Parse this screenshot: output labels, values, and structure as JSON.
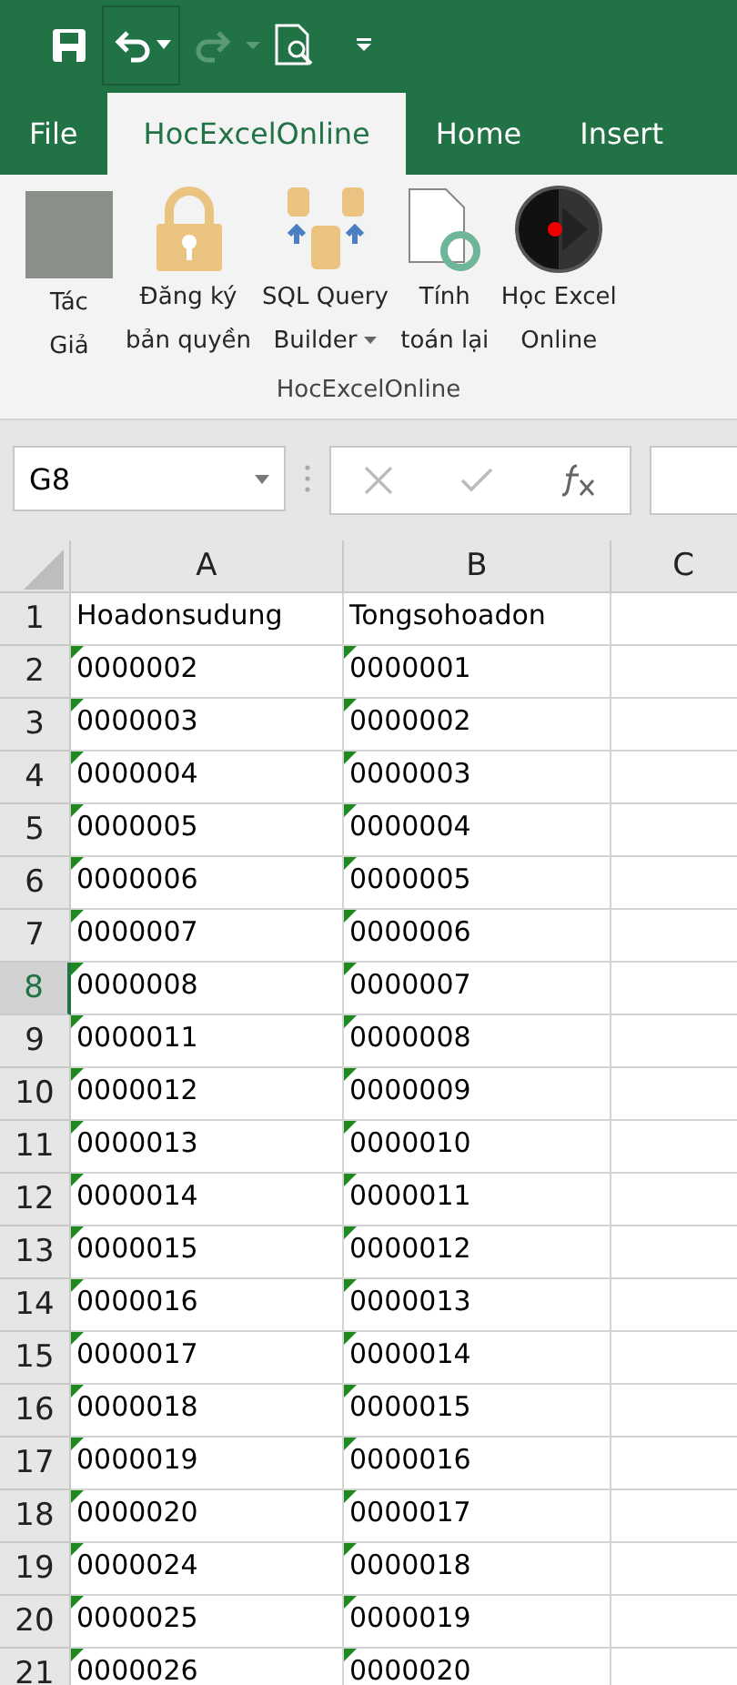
{
  "quick_access": {
    "undo_selected": true
  },
  "tabs": [
    {
      "label": "File",
      "selected": false
    },
    {
      "label": "HocExcelOnline",
      "selected": true
    },
    {
      "label": "Home",
      "selected": false
    },
    {
      "label": "Insert",
      "selected": false
    }
  ],
  "ribbon": {
    "buttons": [
      {
        "kind": "photo",
        "lines": [
          "Tác",
          "Giả"
        ]
      },
      {
        "kind": "lock",
        "lines": [
          "Đăng ký",
          "bản quyền"
        ]
      },
      {
        "kind": "database",
        "lines": [
          "SQL Query",
          "Builder"
        ],
        "dropdown": true
      },
      {
        "kind": "recalc",
        "lines": [
          "Tính",
          "toán lại"
        ]
      },
      {
        "kind": "play",
        "lines": [
          "Học Excel",
          "Online"
        ]
      }
    ],
    "group_label": "HocExcelOnline"
  },
  "name_box": {
    "value": "G8"
  },
  "columns": [
    "A",
    "B",
    "C"
  ],
  "rows": [
    {
      "number": "1",
      "cells": [
        "Hoadonsudung",
        "Tongsohoadon"
      ],
      "selected": false,
      "error_marks": false
    },
    {
      "number": "2",
      "cells": [
        "0000002",
        "0000001"
      ],
      "selected": false,
      "error_marks": true
    },
    {
      "number": "3",
      "cells": [
        "0000003",
        "0000002"
      ],
      "selected": false,
      "error_marks": true
    },
    {
      "number": "4",
      "cells": [
        "0000004",
        "0000003"
      ],
      "selected": false,
      "error_marks": true
    },
    {
      "number": "5",
      "cells": [
        "0000005",
        "0000004"
      ],
      "selected": false,
      "error_marks": true
    },
    {
      "number": "6",
      "cells": [
        "0000006",
        "0000005"
      ],
      "selected": false,
      "error_marks": true
    },
    {
      "number": "7",
      "cells": [
        "0000007",
        "0000006"
      ],
      "selected": false,
      "error_marks": true
    },
    {
      "number": "8",
      "cells": [
        "0000008",
        "0000007"
      ],
      "selected": true,
      "error_marks": true
    },
    {
      "number": "9",
      "cells": [
        "0000011",
        "0000008"
      ],
      "selected": false,
      "error_marks": true
    },
    {
      "number": "10",
      "cells": [
        "0000012",
        "0000009"
      ],
      "selected": false,
      "error_marks": true
    },
    {
      "number": "11",
      "cells": [
        "0000013",
        "0000010"
      ],
      "selected": false,
      "error_marks": true
    },
    {
      "number": "12",
      "cells": [
        "0000014",
        "0000011"
      ],
      "selected": false,
      "error_marks": true
    },
    {
      "number": "13",
      "cells": [
        "0000015",
        "0000012"
      ],
      "selected": false,
      "error_marks": true
    },
    {
      "number": "14",
      "cells": [
        "0000016",
        "0000013"
      ],
      "selected": false,
      "error_marks": true
    },
    {
      "number": "15",
      "cells": [
        "0000017",
        "0000014"
      ],
      "selected": false,
      "error_marks": true
    },
    {
      "number": "16",
      "cells": [
        "0000018",
        "0000015"
      ],
      "selected": false,
      "error_marks": true
    },
    {
      "number": "17",
      "cells": [
        "0000019",
        "0000016"
      ],
      "selected": false,
      "error_marks": true
    },
    {
      "number": "18",
      "cells": [
        "0000020",
        "0000017"
      ],
      "selected": false,
      "error_marks": true
    },
    {
      "number": "19",
      "cells": [
        "0000024",
        "0000018"
      ],
      "selected": false,
      "error_marks": true
    },
    {
      "number": "20",
      "cells": [
        "0000025",
        "0000019"
      ],
      "selected": false,
      "error_marks": true
    },
    {
      "number": "21",
      "cells": [
        "0000026",
        "0000020"
      ],
      "selected": false,
      "error_marks": true
    }
  ]
}
